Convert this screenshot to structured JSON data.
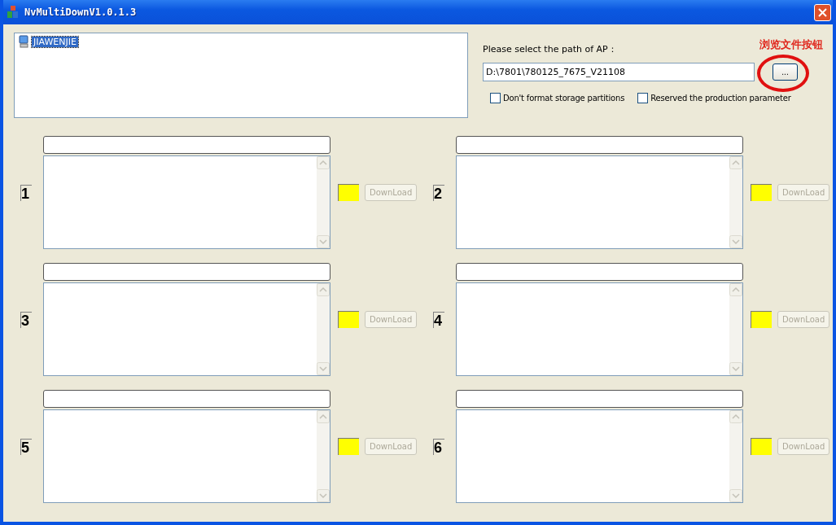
{
  "window": {
    "title": "NvMultiDownV1.0.1.3"
  },
  "devices": [
    {
      "name": "JIAWENJIE",
      "selected": true
    }
  ],
  "ap_path": {
    "label": "Please select the path of AP：",
    "value": "D:\\7801\\780125_7675_V21108",
    "browse_button": "..."
  },
  "annotation": {
    "text": "浏览文件按钮"
  },
  "options": [
    {
      "label": "Don't format storage partitions",
      "checked": false
    },
    {
      "label": "Reserved the production parameter",
      "checked": false
    }
  ],
  "slots": [
    {
      "number": "1",
      "color": "#ffff00",
      "button": "DownLoad",
      "disabled": true
    },
    {
      "number": "2",
      "color": "#ffff00",
      "button": "DownLoad",
      "disabled": true
    },
    {
      "number": "3",
      "color": "#ffff00",
      "button": "DownLoad",
      "disabled": true
    },
    {
      "number": "4",
      "color": "#ffff00",
      "button": "DownLoad",
      "disabled": true
    },
    {
      "number": "5",
      "color": "#ffff00",
      "button": "DownLoad",
      "disabled": true
    },
    {
      "number": "6",
      "color": "#ffff00",
      "button": "DownLoad",
      "disabled": true
    }
  ]
}
